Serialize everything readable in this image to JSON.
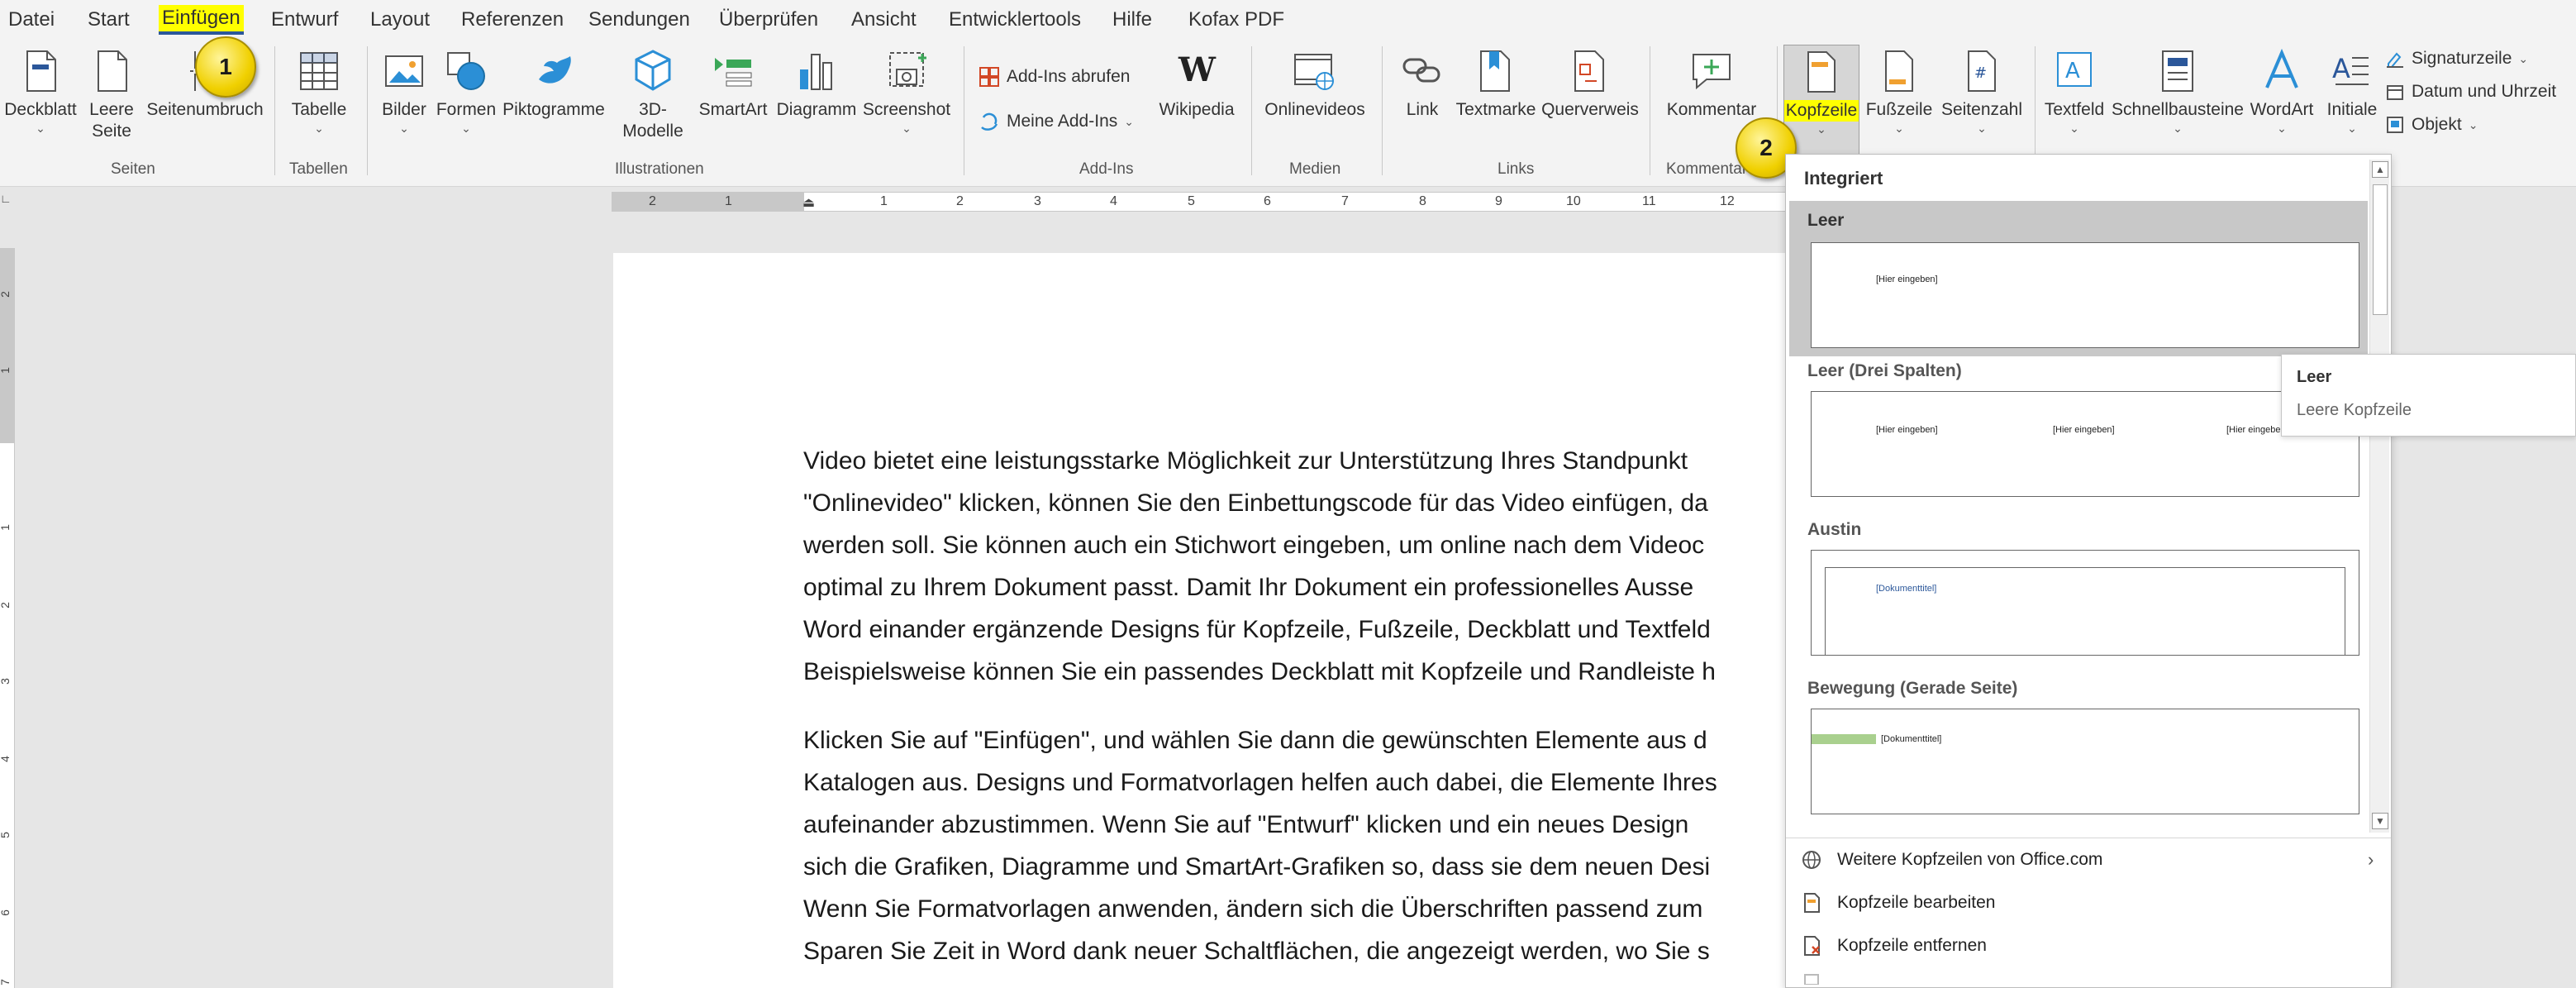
{
  "menu": {
    "tabs": [
      "Datei",
      "Start",
      "Einfügen",
      "Entwurf",
      "Layout",
      "Referenzen",
      "Sendungen",
      "Überprüfen",
      "Ansicht",
      "Entwicklertools",
      "Hilfe",
      "Kofax PDF"
    ],
    "active_tab": "Einfügen"
  },
  "ribbon": {
    "seiten": {
      "deckblatt": "Deckblatt",
      "leere_seite_1": "Leere",
      "leere_seite_2": "Seite",
      "seitenumbruch": "Seitenumbruch",
      "group": "Seiten"
    },
    "tabellen": {
      "tabelle": "Tabelle",
      "group": "Tabellen"
    },
    "illustrationen": {
      "bilder": "Bilder",
      "formen": "Formen",
      "piktogramme": "Piktogramme",
      "modelle_1": "3D-",
      "modelle_2": "Modelle",
      "smartart": "SmartArt",
      "diagramm": "Diagramm",
      "screenshot": "Screenshot",
      "group": "Illustrationen"
    },
    "addins": {
      "abrufen": "Add-Ins abrufen",
      "meine": "Meine Add-Ins",
      "wikipedia": "Wikipedia",
      "group": "Add-Ins"
    },
    "medien": {
      "onlinevideos": "Onlinevideos",
      "group": "Medien"
    },
    "links": {
      "link": "Link",
      "textmarke": "Textmarke",
      "querverweis": "Querverweis",
      "group": "Links"
    },
    "kommentare": {
      "kommentar": "Kommentar",
      "group": "Kommentare"
    },
    "kopf": {
      "kopfzeile": "Kopfzeile",
      "fusszeile": "Fußzeile",
      "seitenzahl": "Seitenzahl"
    },
    "text": {
      "textfeld": "Textfeld",
      "schnellbausteine": "Schnellbausteine",
      "wordart": "WordArt",
      "initiale": "Initiale",
      "signaturzeile": "Signaturzeile",
      "datum": "Datum und Uhrzeit",
      "objekt": "Objekt"
    }
  },
  "badges": {
    "one": "1",
    "two": "2"
  },
  "ruler": {
    "h": [
      "2",
      "1",
      "1",
      "1",
      "2",
      "3",
      "4",
      "5",
      "6",
      "7",
      "8",
      "9",
      "10",
      "11",
      "12"
    ],
    "v": [
      "2",
      "1",
      "1",
      "1",
      "2",
      "3",
      "4",
      "5",
      "6",
      "7"
    ]
  },
  "document": {
    "lines": [
      "Video bietet eine leistungsstarke Möglichkeit zur Unterstützung Ihres Standpunkt",
      "\"Onlinevideo\" klicken, können Sie den Einbettungscode für das Video einfügen, da",
      "werden soll. Sie können auch ein Stichwort eingeben, um online nach dem Videoc",
      "optimal zu Ihrem Dokument passt. Damit Ihr Dokument ein professionelles Ausse",
      "Word einander ergänzende Designs für Kopfzeile, Fußzeile, Deckblatt und Textfeld",
      "Beispielsweise können Sie ein passendes Deckblatt mit Kopfzeile und Randleiste h",
      "Klicken Sie auf \"Einfügen\", und wählen Sie dann die gewünschten Elemente aus d",
      "Katalogen aus. Designs und Formatvorlagen helfen auch dabei, die Elemente Ihres",
      "aufeinander abzustimmen. Wenn Sie auf \"Entwurf\" klicken und ein neues Design",
      "sich die Grafiken, Diagramme und SmartArt-Grafiken so, dass sie dem neuen Desi",
      "Wenn Sie Formatvorlagen anwenden, ändern sich die Überschriften passend zum",
      "Sparen Sie Zeit in Word dank neuer Schaltflächen, die angezeigt werden, wo Sie s"
    ]
  },
  "dropdown": {
    "header": "Integriert",
    "items": [
      {
        "title": "Leer",
        "placeholders": [
          "[Hier eingeben]"
        ]
      },
      {
        "title": "Leer (Drei Spalten)",
        "placeholders": [
          "[Hier eingeben]",
          "[Hier eingeben]",
          "[Hier eingeben]"
        ]
      },
      {
        "title": "Austin",
        "placeholders": [
          "[Dokumenttitel]"
        ]
      },
      {
        "title": "Bewegung (Gerade Seite)",
        "placeholders": [
          "[Dokumenttitel]"
        ]
      }
    ],
    "commands": {
      "weitere": "Weitere Kopfzeilen von Office.com",
      "bearbeiten": "Kopfzeile bearbeiten",
      "entfernen": "Kopfzeile entfernen"
    }
  },
  "tooltip": {
    "title": "Leer",
    "desc": "Leere Kopfzeile"
  },
  "colors": {
    "accent": "#2b579a",
    "highlight": "#ffff00",
    "badge": "#f0d000"
  }
}
